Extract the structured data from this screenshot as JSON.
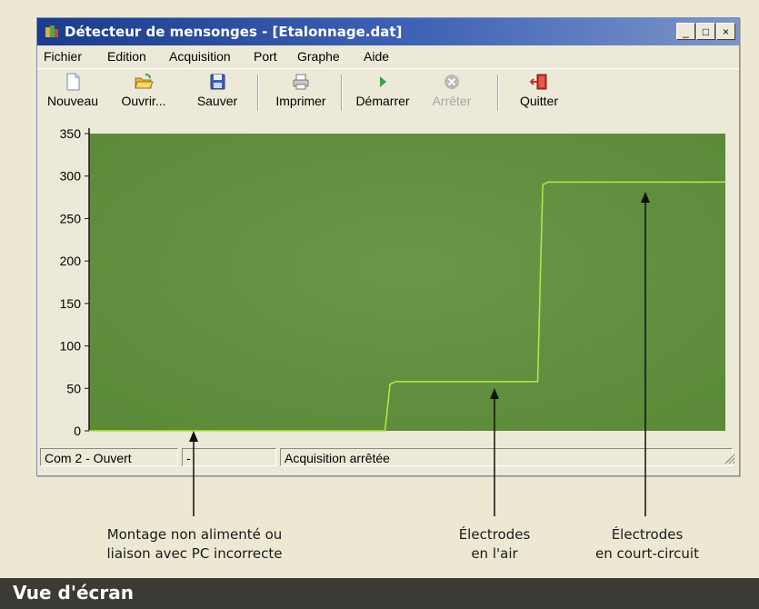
{
  "window": {
    "title": "Détecteur de mensonges - [Etalonnage.dat]",
    "controls": {
      "minimize": "_",
      "maximize": "□",
      "close": "×"
    }
  },
  "menu": [
    "Fichier",
    "Edition",
    "Acquisition",
    "Port",
    "Graphe",
    "Aide"
  ],
  "toolbar": [
    {
      "label": "Nouveau",
      "icon": "new-document-icon",
      "enabled": true
    },
    {
      "label": "Ouvrir...",
      "icon": "open-folder-icon",
      "enabled": true
    },
    {
      "label": "Sauver",
      "icon": "save-disk-icon",
      "enabled": true
    },
    {
      "label": "Imprimer",
      "icon": "printer-icon",
      "enabled": true
    },
    {
      "label": "Démarrer",
      "icon": "play-icon",
      "enabled": true
    },
    {
      "label": "Arrêter",
      "icon": "stop-icon",
      "enabled": false
    },
    {
      "label": "Quitter",
      "icon": "exit-door-icon",
      "enabled": true
    }
  ],
  "chart_data": {
    "type": "line",
    "title": "",
    "xlabel": "",
    "ylabel": "",
    "ylim": [
      0,
      350
    ],
    "yticks": [
      0,
      50,
      100,
      150,
      200,
      250,
      300,
      350
    ],
    "xlim": [
      0,
      100
    ],
    "grid": true,
    "background": "#5b8a39",
    "line_color": "#b6e04a",
    "series": [
      {
        "values": [
          [
            0,
            0
          ],
          [
            46.5,
            0
          ],
          [
            47.3,
            55
          ],
          [
            48.2,
            58
          ],
          [
            70.5,
            58
          ],
          [
            71.3,
            290
          ],
          [
            72.2,
            293
          ],
          [
            100,
            293
          ]
        ]
      }
    ]
  },
  "status": {
    "port": "Com 2 - Ouvert",
    "second": "-",
    "acquisition": "Acquisition arrêtée"
  },
  "annotations": [
    {
      "line1": "Montage non alimenté ou",
      "line2": "liaison avec PC incorrecte"
    },
    {
      "line1": "Électrodes",
      "line2": "en l'air"
    },
    {
      "line1": "Électrodes",
      "line2": "en court-circuit"
    }
  ],
  "footer": {
    "caption": "Vue d'écran"
  }
}
